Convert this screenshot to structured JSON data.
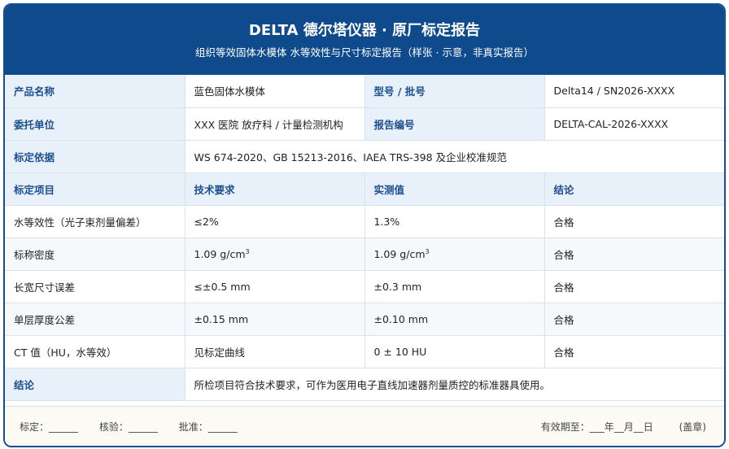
{
  "header": {
    "title": "DELTA 德尔塔仪器 · 原厂标定报告",
    "subtitle": "组织等效固体水模体 水等效性与尺寸标定报告（样张 · 示意，非真实报告）"
  },
  "info": {
    "product_label": "产品名称",
    "product_value": "蓝色固体水模体",
    "model_label": "型号 / 批号",
    "model_value": "Delta14 / SN2026-XXXX",
    "client_label": "委托单位",
    "client_value": "XXX 医院 放疗科 / 计量检测机构",
    "report_label": "报告编号",
    "report_value": "DELTA-CAL-2026-XXXX",
    "basis_label": "标定依据",
    "basis_value": "WS 674-2020、GB 15213-2016、IAEA TRS-398 及企业校准规范"
  },
  "table": {
    "headers": [
      "标定项目",
      "技术要求",
      "实测值",
      "结论"
    ],
    "rows": [
      {
        "item": "水等效性（光子束剂量偏差）",
        "req": "≤2%",
        "meas": "1.3%",
        "result": "合格"
      },
      {
        "item": "标称密度",
        "req": "1.09 g/cm",
        "req_sup": "3",
        "meas": "1.09 g/cm",
        "meas_sup": "3",
        "result": "合格"
      },
      {
        "item": "长宽尺寸误差",
        "req": "≤±0.5 mm",
        "meas": "±0.3 mm",
        "result": "合格"
      },
      {
        "item": "单层厚度公差",
        "req": "±0.15 mm",
        "meas": "±0.10 mm",
        "result": "合格"
      },
      {
        "item": "CT 值（HU，水等效）",
        "req": "见标定曲线",
        "meas": "0 ± 10 HU",
        "result": "合格"
      }
    ]
  },
  "conclusion": {
    "label": "结论",
    "text": "所检项目符合技术要求，可作为医用电子直线加速器剂量质控的标准器具使用。"
  },
  "footer": {
    "calibrator": "标定：______",
    "checker": "核验：______",
    "approver": "批准：______",
    "valid_until": "有效期至：___年__月__日",
    "seal": "(盖章)"
  },
  "colors": {
    "header_bg": "#0e4a8c",
    "label_bg": "#e8f0f9",
    "label_text": "#1b4f8f"
  }
}
